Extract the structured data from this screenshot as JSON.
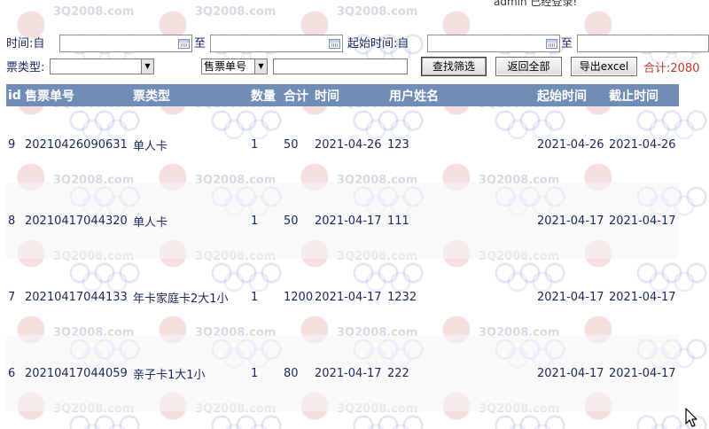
{
  "status": {
    "logged_in_text": "admin 已经登录!"
  },
  "filters": {
    "time_from_label": "时间:自",
    "to_label_1": "至",
    "start_time_from_label": "起始时间:自",
    "to_label_2": "至",
    "ticket_type_label": "票类型:",
    "ticket_type_value": "",
    "field_select_value": "售票单号",
    "keyword_value": "",
    "search_button": "查找筛选",
    "reset_button": "返回全部",
    "export_button": "导出excel",
    "total_label": "合计:2080"
  },
  "table": {
    "headers": {
      "id": "id",
      "order_no": "售票单号",
      "type": "票类型",
      "qty": "数量",
      "total": "合计",
      "time": "时间",
      "user": "用户姓名",
      "start": "起始时间",
      "end": "截止时间"
    },
    "rows": [
      {
        "id": "9",
        "order_no": "20210426090631",
        "type": "单人卡",
        "qty": "1",
        "total": "50",
        "time": "2021-04-26",
        "user": "123",
        "start": "2021-04-26",
        "end": "2021-04-26"
      },
      {
        "id": "8",
        "order_no": "20210417044320",
        "type": "单人卡",
        "qty": "1",
        "total": "50",
        "time": "2021-04-17",
        "user": "111",
        "start": "2021-04-17",
        "end": "2021-04-17"
      },
      {
        "id": "7",
        "order_no": "20210417044133",
        "type": "年卡家庭卡2大1小",
        "qty": "1",
        "total": "1200",
        "time": "2021-04-17",
        "user": "1232",
        "start": "2021-04-17",
        "end": "2021-04-17"
      },
      {
        "id": "6",
        "order_no": "20210417044059",
        "type": "亲子卡1大1小",
        "qty": "1",
        "total": "80",
        "time": "2021-04-17",
        "user": "222",
        "start": "2021-04-17",
        "end": "2021-04-17"
      }
    ]
  },
  "watermark": {
    "text": "3Q2008.com"
  },
  "colors": {
    "header_bg": "#6f8db6",
    "total_text": "#c0392b",
    "body_text": "#1a2a60"
  }
}
